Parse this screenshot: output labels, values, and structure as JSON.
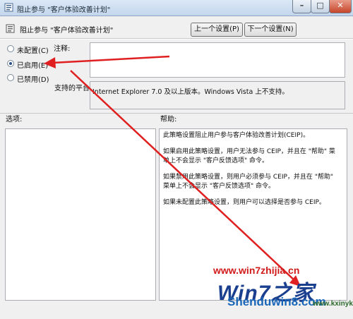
{
  "window": {
    "title": "阻止参与 \"客户体验改善计划\"",
    "minimize_glyph": "–",
    "maximize_glyph": "□",
    "close_glyph": "✕"
  },
  "policy": {
    "name": "阻止参与 \"客户体验改善计划\""
  },
  "nav": {
    "prev_label": "上一个设置(P)",
    "next_label": "下一个设置(N)"
  },
  "radios": [
    {
      "label": "未配置(C)",
      "checked": false
    },
    {
      "label": "已启用(E)",
      "checked": true
    },
    {
      "label": "已禁用(D)",
      "checked": false
    }
  ],
  "fields": {
    "comment_label": "注释:",
    "comment_value": "",
    "platform_label": "支持的平台:",
    "platform_value": "Internet Explorer 7.0 及以上版本。Windows Vista 上不支持。"
  },
  "sections": {
    "options_label": "选项:",
    "help_label": "帮助:"
  },
  "help": {
    "paragraphs": [
      "此策略设置阻止用户参与客户体验改善计划(CEIP)。",
      "如果启用此策略设置，用户无法参与 CEIP，并且在 \"帮助\" 菜单上不会显示 \"客户反馈选项\" 命令。",
      "如果禁用此策略设置，则用户必须参与 CEIP，并且在 \"帮助\" 菜单上不会显示 \"客户反馈选项\" 命令。",
      "如果未配置此策略设置，则用户可以选择是否参与 CEIP。"
    ]
  },
  "watermark": {
    "line1": "www.win7zhijia.cn",
    "line2": "Win7之家",
    "line3": "Shenduwin8.com",
    "line4": "www.kxinyk.com"
  },
  "colors": {
    "annotation_arrow": "#e02020",
    "title_gradient_top": "#dbe8f6",
    "close_button": "#c6452a"
  }
}
